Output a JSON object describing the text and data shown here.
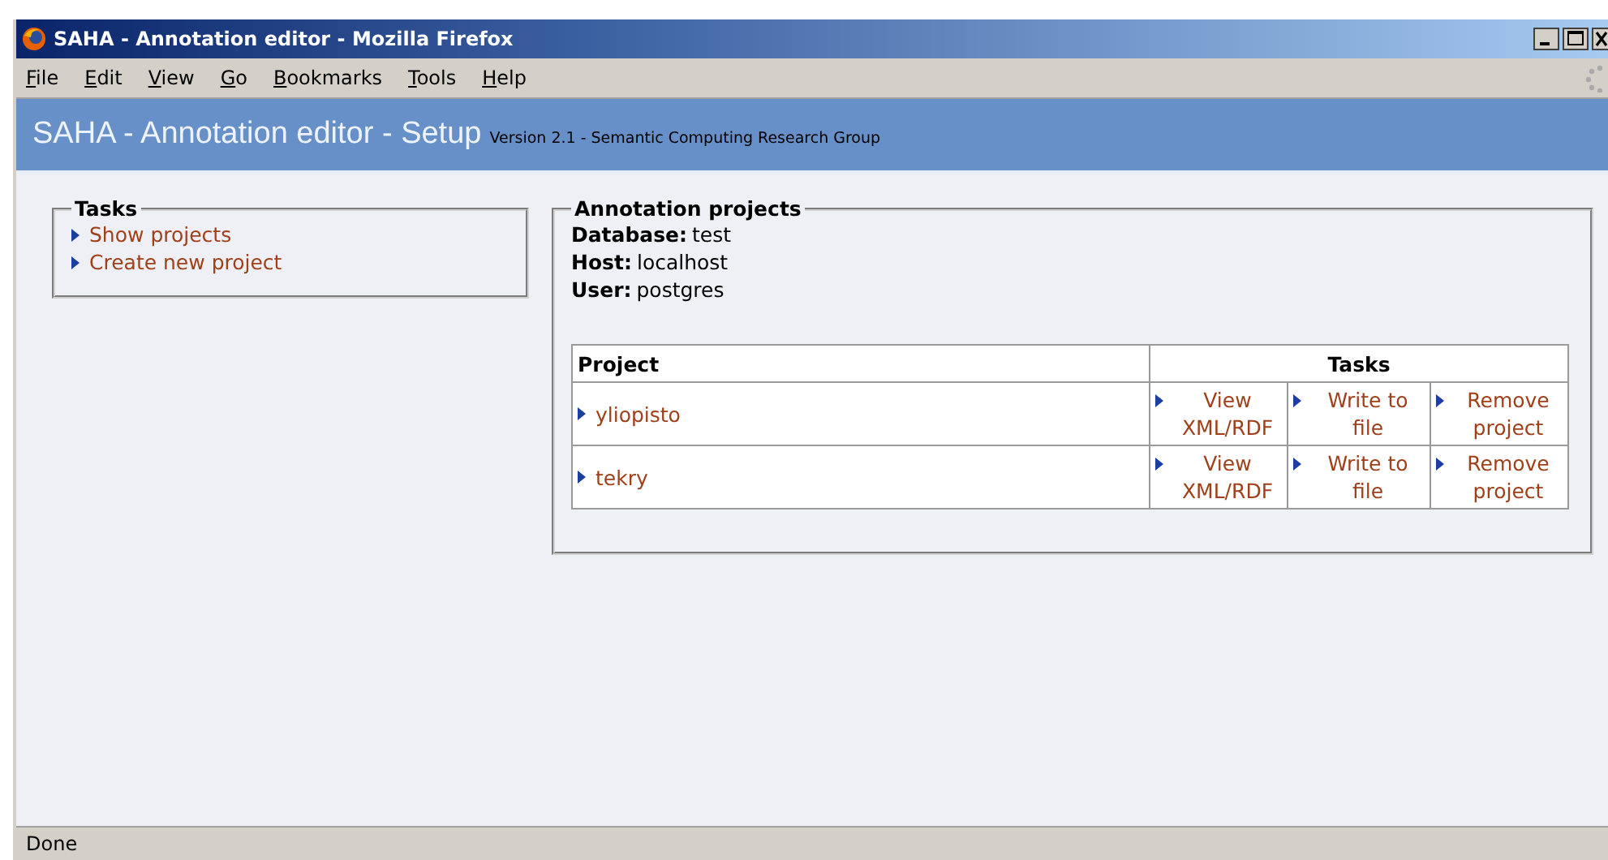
{
  "window": {
    "title": "SAHA - Annotation editor - Mozilla Firefox"
  },
  "menu": [
    "File",
    "Edit",
    "View",
    "Go",
    "Bookmarks",
    "Tools",
    "Help"
  ],
  "header": {
    "title": "SAHA - Annotation editor - Setup",
    "subtitle": "Version 2.1 - Semantic Computing Research Group"
  },
  "tasks": {
    "legend": "Tasks",
    "links": [
      "Show projects",
      "Create new project"
    ]
  },
  "projects": {
    "legend": "Annotation projects",
    "info": [
      {
        "label": "Database:",
        "value": "test"
      },
      {
        "label": "Host:",
        "value": "localhost"
      },
      {
        "label": "User:",
        "value": "postgres"
      }
    ],
    "table": {
      "columns": [
        "Project",
        "Tasks"
      ],
      "rows": [
        {
          "name": "yliopisto",
          "actions": [
            "View XML/RDF",
            "Write to file",
            "Remove project"
          ]
        },
        {
          "name": "tekry",
          "actions": [
            "View XML/RDF",
            "Write to file",
            "Remove project"
          ]
        }
      ]
    }
  },
  "status_bar": "Done"
}
